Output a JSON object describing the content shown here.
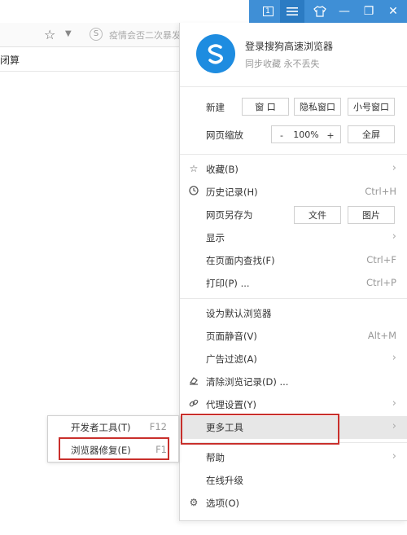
{
  "titlebar": {
    "tab_count": "1",
    "menu_icon": "hamburger-icon",
    "skin_icon": "shirt-icon",
    "minimize": "—",
    "restore": "❐",
    "close": "✕"
  },
  "browser": {
    "address_hint": "疫情会否二次暴发",
    "bookmark_item": "闭算"
  },
  "menu": {
    "login_title": "登录搜狗高速浏览器",
    "login_sub": "同步收藏 永不丢失",
    "new_label": "新建",
    "new_window": "窗 口",
    "private_window": "隐私窗口",
    "small_window": "小号窗口",
    "zoom_label": "网页缩放",
    "zoom_minus": "-",
    "zoom_value": "100%",
    "zoom_plus": "+",
    "fullscreen": "全屏",
    "items": [
      {
        "label": "收藏(B)",
        "shortcut": "",
        "arrow": "›",
        "icon": "star-icon"
      },
      {
        "label": "历史记录(H)",
        "shortcut": "Ctrl+H",
        "arrow": "",
        "icon": "clock-icon"
      },
      {
        "label": "网页另存为",
        "shortcut": "",
        "arrow": "",
        "icon": ""
      },
      {
        "label": "显示",
        "shortcut": "",
        "arrow": "›",
        "icon": ""
      },
      {
        "label": "在页面内查找(F)",
        "shortcut": "Ctrl+F",
        "arrow": "",
        "icon": ""
      },
      {
        "label": "打印(P) ...",
        "shortcut": "Ctrl+P",
        "arrow": "",
        "icon": ""
      },
      {
        "label": "设为默认浏览器",
        "shortcut": "",
        "arrow": "",
        "icon": ""
      },
      {
        "label": "页面静音(V)",
        "shortcut": "Alt+M",
        "arrow": "",
        "icon": ""
      },
      {
        "label": "广告过滤(A)",
        "shortcut": "",
        "arrow": "›",
        "icon": ""
      },
      {
        "label": "清除浏览记录(D) ...",
        "shortcut": "",
        "arrow": "",
        "icon": "eraser-icon"
      },
      {
        "label": "代理设置(Y)",
        "shortcut": "",
        "arrow": "›",
        "icon": "link-icon"
      },
      {
        "label": "更多工具",
        "shortcut": "",
        "arrow": "›",
        "icon": ""
      },
      {
        "label": "帮助",
        "shortcut": "",
        "arrow": "›",
        "icon": ""
      },
      {
        "label": "在线升级",
        "shortcut": "",
        "arrow": "",
        "icon": ""
      },
      {
        "label": "选项(O)",
        "shortcut": "",
        "arrow": "",
        "icon": "gear-icon"
      }
    ],
    "save_as_file": "文件",
    "save_as_image": "图片"
  },
  "submenu": {
    "items": [
      {
        "label": "开发者工具(T)",
        "shortcut": "F12"
      },
      {
        "label": "浏览器修复(E)",
        "shortcut": "F1"
      }
    ]
  },
  "colors": {
    "titlebar_blue": "#3f8fd6",
    "highlight_red": "#c9302c",
    "logo_blue": "#1e8ce0"
  }
}
